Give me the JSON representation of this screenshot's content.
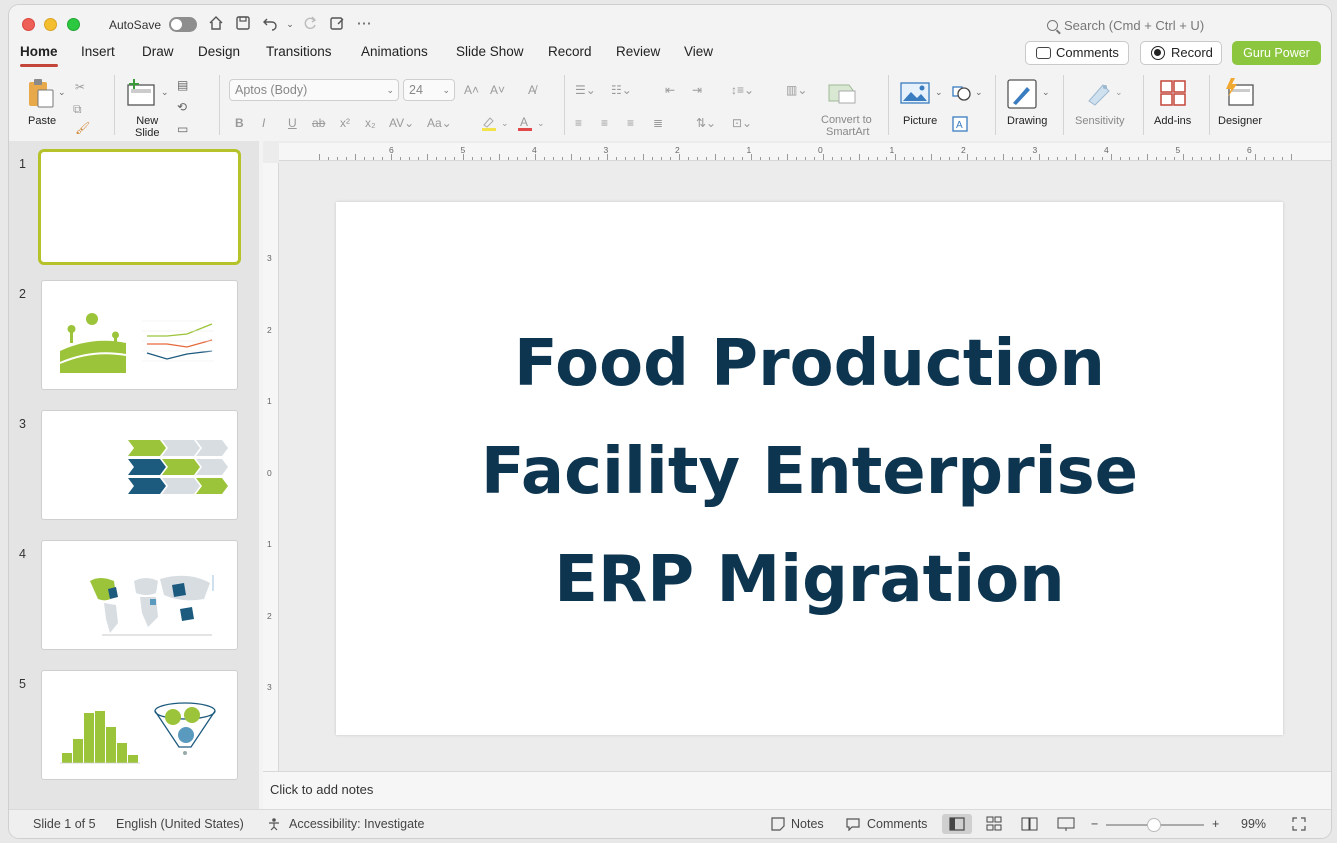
{
  "titlebar": {
    "autosave_label": "AutoSave",
    "search_placeholder": "Search (Cmd + Ctrl + U)"
  },
  "tabs": [
    {
      "label": "Home",
      "active": true
    },
    {
      "label": "Insert"
    },
    {
      "label": "Draw"
    },
    {
      "label": "Design"
    },
    {
      "label": "Transitions"
    },
    {
      "label": "Animations"
    },
    {
      "label": "Slide Show"
    },
    {
      "label": "Record"
    },
    {
      "label": "Review"
    },
    {
      "label": "View"
    }
  ],
  "actions": {
    "comments_label": "Comments",
    "record_label": "Record",
    "guru_label": "Guru Power"
  },
  "ribbon": {
    "paste_label": "Paste",
    "new_slide_label": "New\nSlide",
    "font_name": "Aptos (Body)",
    "font_size": "24",
    "convert_label_1": "Convert to",
    "convert_label_2": "SmartArt",
    "picture_label": "Picture",
    "drawing_label": "Drawing",
    "sensitivity_label": "Sensitivity",
    "addins_label": "Add-ins",
    "designer_label": "Designer"
  },
  "slides_panel": {
    "numbers": [
      "1",
      "2",
      "3",
      "4",
      "5"
    ],
    "selected": 1
  },
  "slide": {
    "title_lines": [
      "Food Production",
      "Facility Enterprise",
      "ERP Migration"
    ],
    "title_color": "#0d3550"
  },
  "ruler": {
    "h_labels": [
      "6",
      "5",
      "4",
      "3",
      "2",
      "1",
      "0",
      "1",
      "2",
      "3",
      "4",
      "5",
      "6"
    ],
    "v_labels": [
      "3",
      "2",
      "1",
      "0",
      "1",
      "2",
      "3"
    ]
  },
  "notes": {
    "placeholder": "Click to add notes"
  },
  "status": {
    "slide_info": "Slide 1 of 5",
    "language": "English (United States)",
    "accessibility": "Accessibility: Investigate",
    "notes_label": "Notes",
    "comments_label": "Comments",
    "zoom_percent": "99%",
    "zoom_minus": "−",
    "zoom_plus": "+"
  },
  "colors": {
    "accent_tab": "#c4463a",
    "guru_green": "#8cc63f",
    "thumb_selected": "#b5c22a",
    "thumb_green": "#9cc43a",
    "thumb_navy": "#1c5a7e"
  }
}
